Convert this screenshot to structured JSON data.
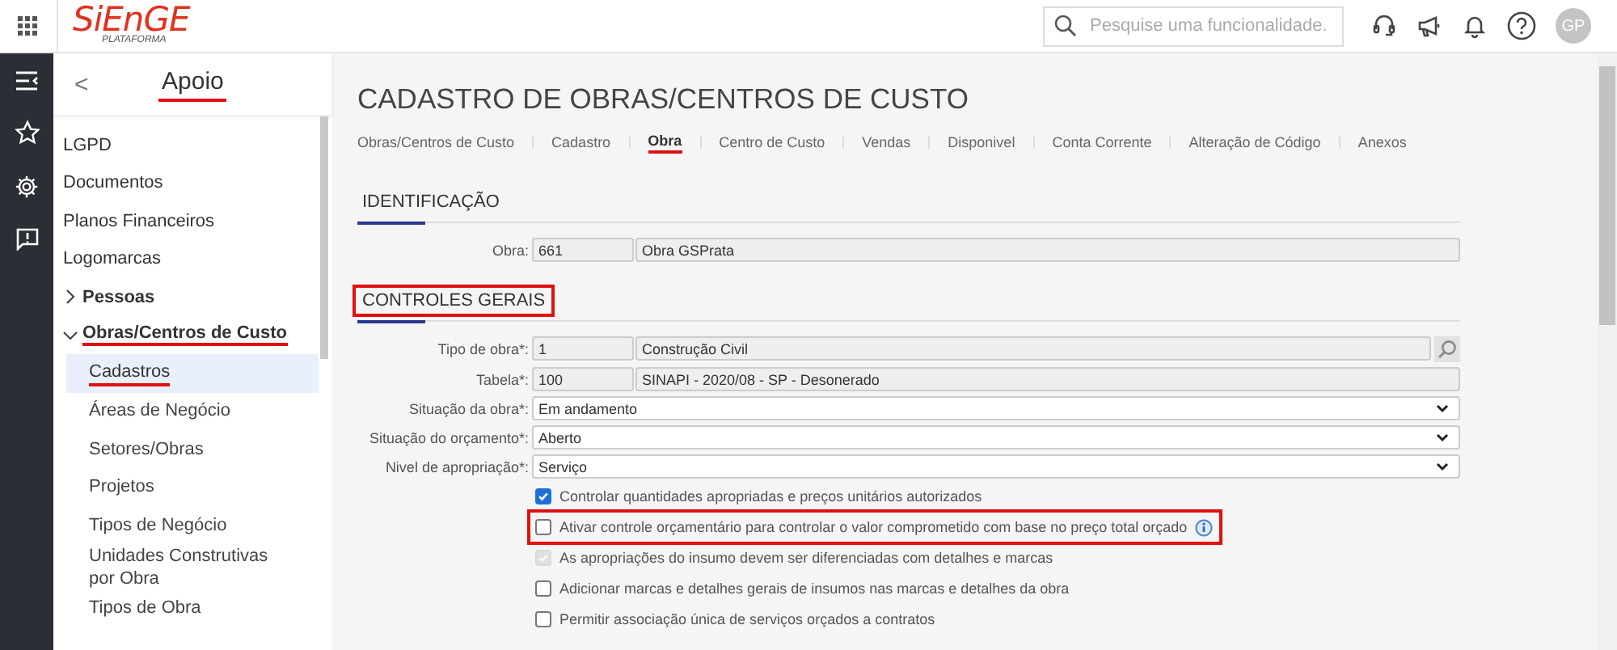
{
  "header": {
    "logo": {
      "brand": "SiEnGE",
      "subtitle": "PLATAFORMA"
    },
    "search": {
      "placeholder": "Pesquise uma funcionalidade."
    },
    "avatar": "GP"
  },
  "sidebar": {
    "title": "Apoio",
    "title_annotated": true,
    "back": "<",
    "items": [
      {
        "label": "LGPD",
        "kind": "link"
      },
      {
        "label": "Documentos",
        "kind": "link"
      },
      {
        "label": "Planos Financeiros",
        "kind": "link"
      },
      {
        "label": "Logomarcas",
        "kind": "link"
      },
      {
        "label": "Pessoas",
        "kind": "group",
        "expanded": false,
        "annotated": false
      },
      {
        "label": "Obras/Centros de Custo",
        "kind": "group",
        "expanded": true,
        "annotated": true,
        "children": [
          {
            "label": "Cadastros",
            "selected": true,
            "annotated": true
          },
          {
            "label": "Áreas de Negócio",
            "selected": false,
            "annotated": false
          },
          {
            "label": "Setores/Obras",
            "selected": false,
            "annotated": false
          },
          {
            "label": "Projetos",
            "selected": false,
            "annotated": false
          },
          {
            "label": "Tipos de Negócio",
            "selected": false,
            "annotated": false
          },
          {
            "label": "Unidades Construtivas por Obra",
            "selected": false,
            "annotated": false
          },
          {
            "label": "Tipos de Obra",
            "selected": false,
            "annotated": false
          }
        ]
      }
    ]
  },
  "page": {
    "title": "CADASTRO DE OBRAS/CENTROS DE CUSTO",
    "tabs": [
      {
        "label": "Obras/Centros de Custo",
        "selected": false
      },
      {
        "label": "Cadastro",
        "selected": false
      },
      {
        "label": "Obra",
        "selected": true
      },
      {
        "label": "Centro de Custo",
        "selected": false
      },
      {
        "label": "Vendas",
        "selected": false
      },
      {
        "label": "Disponivel",
        "selected": false
      },
      {
        "label": "Conta Corrente",
        "selected": false
      },
      {
        "label": "Alteração de Código",
        "selected": false
      },
      {
        "label": "Anexos",
        "selected": false
      }
    ],
    "sections": [
      {
        "title": "IDENTIFICAÇÃO",
        "fields": [
          {
            "kind": "pair",
            "label": "Obra:",
            "code": "661",
            "value": "Obra GSPrata",
            "lookup": false
          }
        ]
      },
      {
        "title": "CONTROLES GERAIS",
        "annotated": true,
        "fields": [
          {
            "kind": "pair",
            "label": "Tipo de obra*:",
            "code": "1",
            "value": "Construção Civil",
            "lookup": true
          },
          {
            "kind": "pair",
            "label": "Tabela*:",
            "code": "100",
            "value": "SINAPI - 2020/08 - SP - Desonerado",
            "lookup": false
          },
          {
            "kind": "select",
            "label": "Situação da obra*:",
            "value": "Em andamento"
          },
          {
            "kind": "select",
            "label": "Situação do orçamento*:",
            "value": "Aberto"
          },
          {
            "kind": "select",
            "label": "Nivel de apropriação*:",
            "value": "Serviço"
          }
        ],
        "checks": [
          {
            "label": "Controlar quantidades apropriadas e preços unitários autorizados",
            "checked": true,
            "disabled": false,
            "info": false,
            "annotated": false
          },
          {
            "label": "Ativar controle orçamentário para controlar o valor comprometido com base no preço total orçado",
            "checked": false,
            "disabled": false,
            "info": true,
            "annotated": true
          },
          {
            "label": "As apropriações do insumo devem ser diferenciadas com detalhes e marcas",
            "checked": true,
            "disabled": true,
            "info": false,
            "annotated": false
          },
          {
            "label": "Adicionar marcas e detalhes gerais de insumos nas marcas e detalhes da obra",
            "checked": false,
            "disabled": false,
            "info": false,
            "annotated": false
          },
          {
            "label": "Permitir associação única de serviços orçados a contratos",
            "checked": false,
            "disabled": false,
            "info": false,
            "annotated": false
          }
        ]
      }
    ]
  }
}
